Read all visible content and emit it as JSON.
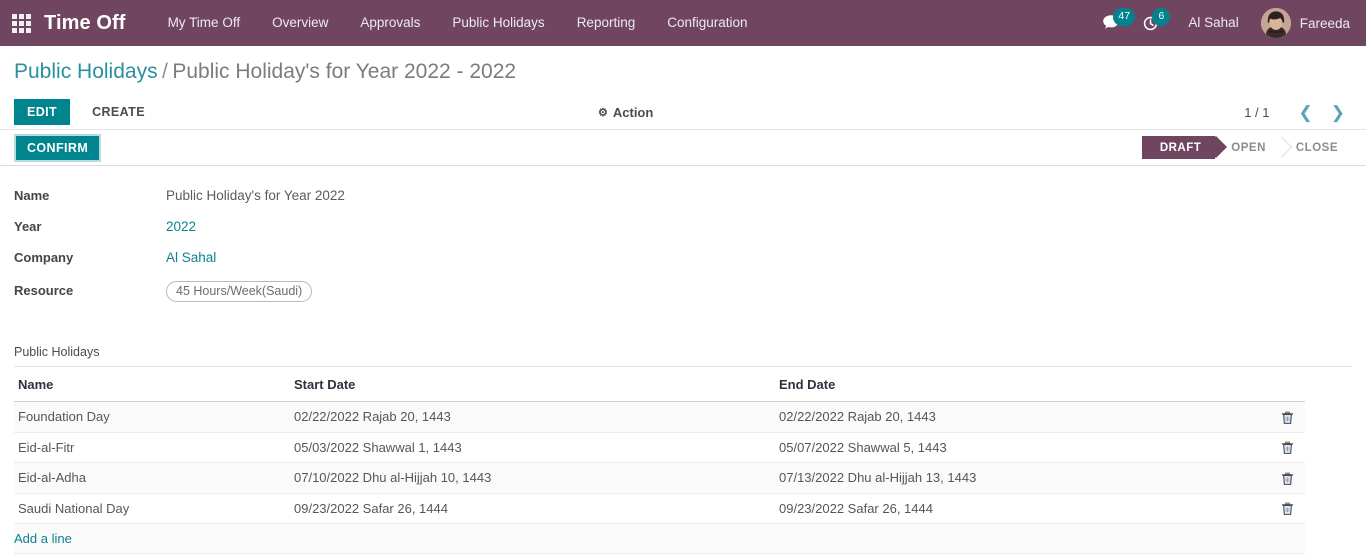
{
  "navbar": {
    "apps_icon": "apps-grid-icon",
    "brand": "Time Off",
    "menu": [
      {
        "label": "My Time Off"
      },
      {
        "label": "Overview"
      },
      {
        "label": "Approvals"
      },
      {
        "label": "Public Holidays"
      },
      {
        "label": "Reporting"
      },
      {
        "label": "Configuration"
      }
    ],
    "messages_icon": "chat-bubble-icon",
    "messages_count": "47",
    "activities_icon": "clock-icon",
    "activities_count": "6",
    "company": "Al Sahal",
    "avatar_icon": "user-avatar",
    "user": "Fareeda",
    "accent_purple": "#6f4560",
    "accent_teal": "#00848e"
  },
  "breadcrumb": {
    "root": "Public Holidays",
    "separator": "/",
    "current": "Public Holiday's for Year 2022 - 2022"
  },
  "controls": {
    "edit_label": "EDIT",
    "create_label": "CREATE",
    "action_icon": "gear-icon",
    "action_label": "Action",
    "pager_count": "1 / 1",
    "prev_icon": "chevron-left-icon",
    "prev_glyph": "❮",
    "next_icon": "chevron-right-icon",
    "next_glyph": "❯"
  },
  "statusbar": {
    "confirm_label": "CONFIRM",
    "stages": [
      {
        "label": "DRAFT",
        "active": true
      },
      {
        "label": "OPEN",
        "active": false
      },
      {
        "label": "CLOSE",
        "active": false
      }
    ]
  },
  "form": {
    "fields": [
      {
        "label": "Name",
        "value": "Public Holiday's for Year 2022",
        "type": "text"
      },
      {
        "label": "Year",
        "value": "2022",
        "type": "link"
      },
      {
        "label": "Company",
        "value": "Al Sahal",
        "type": "link"
      },
      {
        "label": "Resource",
        "value": "45 Hours/Week(Saudi)",
        "type": "tag"
      }
    ]
  },
  "list": {
    "title": "Public Holidays",
    "columns": {
      "name": "Name",
      "start_date": "Start Date",
      "end_date": "End Date"
    },
    "delete_icon": "trash-icon",
    "rows": [
      {
        "name": "Foundation Day",
        "start_date": "02/22/2022 Rajab 20, 1443",
        "end_date": "02/22/2022 Rajab 20, 1443"
      },
      {
        "name": "Eid-al-Fitr",
        "start_date": "05/03/2022 Shawwal 1, 1443",
        "end_date": "05/07/2022 Shawwal 5, 1443"
      },
      {
        "name": "Eid-al-Adha",
        "start_date": "07/10/2022 Dhu al-Hijjah 10, 1443",
        "end_date": "07/13/2022 Dhu al-Hijjah 13, 1443"
      },
      {
        "name": "Saudi National Day",
        "start_date": "09/23/2022 Safar 26, 1444",
        "end_date": "09/23/2022 Safar 26, 1444"
      }
    ],
    "add_line_label": "Add a line"
  }
}
